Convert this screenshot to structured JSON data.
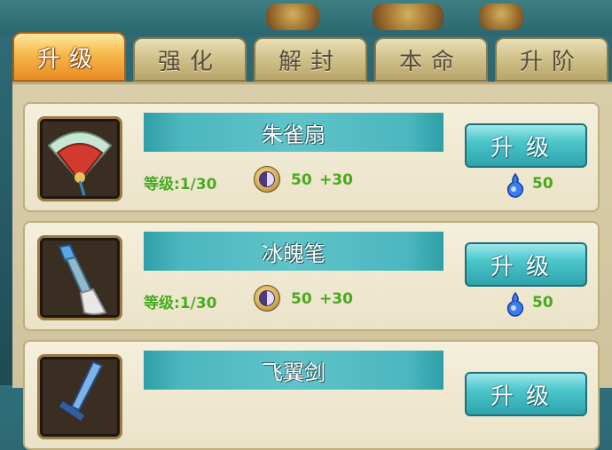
{
  "tabs": [
    {
      "label": "升级",
      "active": true
    },
    {
      "label": "强化",
      "active": false
    },
    {
      "label": "解封",
      "active": false
    },
    {
      "label": "本命",
      "active": false
    },
    {
      "label": "升阶",
      "active": false
    }
  ],
  "items": [
    {
      "name": "朱雀扇",
      "level": "等级:1/30",
      "cost": "50",
      "bonus": "+30",
      "button": "升级",
      "gem_cost": "50",
      "icon": "fan-icon"
    },
    {
      "name": "冰魄笔",
      "level": "等级:1/30",
      "cost": "50",
      "bonus": "+30",
      "button": "升级",
      "gem_cost": "50",
      "icon": "brush-icon"
    },
    {
      "name": "飞翼剑",
      "level": "",
      "cost": "",
      "bonus": "",
      "button": "升级",
      "gem_cost": "",
      "icon": "sword-icon"
    }
  ],
  "colors": {
    "accent_green": "#48a91c",
    "teal": "#4bb7be",
    "active_tab": "#f7b84a"
  }
}
